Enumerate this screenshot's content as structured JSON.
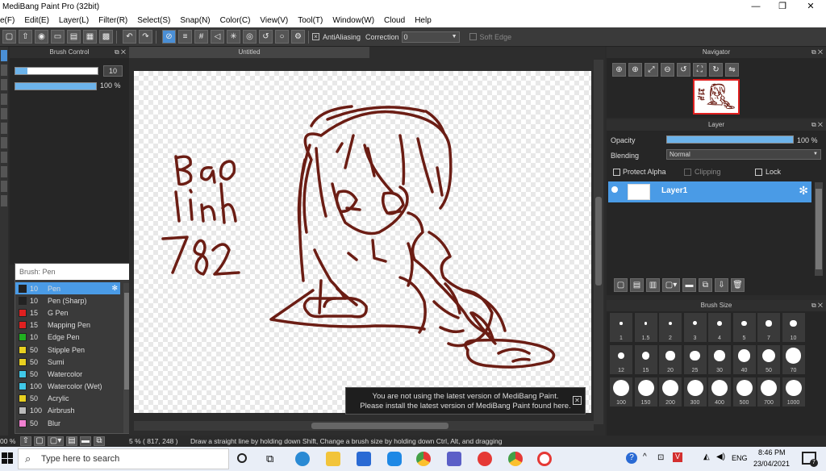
{
  "window": {
    "title": "MediBang Paint Pro (32bit)",
    "minimize": "—",
    "restore": "❐",
    "close": "✕"
  },
  "menu": [
    "e(F)",
    "Edit(E)",
    "Layer(L)",
    "Filter(R)",
    "Select(S)",
    "Snap(N)",
    "Color(C)",
    "View(V)",
    "Tool(T)",
    "Window(W)",
    "Cloud",
    "Help"
  ],
  "toolbar": {
    "antialiasing_label": "AntiAliasing",
    "correction_label": "Correction",
    "correction_value": "0",
    "soft_edge_label": "Soft Edge"
  },
  "brush_control": {
    "title": "Brush Control",
    "size_value": "10",
    "size_fraction": 0.15,
    "opacity_value": "100 %",
    "opacity_fraction": 1.0
  },
  "brush_list": {
    "header": "Brush: Pen",
    "items": [
      {
        "size": "10",
        "name": "Pen",
        "color": "#222222",
        "selected": true
      },
      {
        "size": "10",
        "name": "Pen (Sharp)",
        "color": "#222222"
      },
      {
        "size": "15",
        "name": "G Pen",
        "color": "#e02020"
      },
      {
        "size": "15",
        "name": "Mapping Pen",
        "color": "#e02020"
      },
      {
        "size": "10",
        "name": "Edge Pen",
        "color": "#20b020"
      },
      {
        "size": "50",
        "name": "Stipple Pen",
        "color": "#e8d020"
      },
      {
        "size": "50",
        "name": "Sumi",
        "color": "#e8d020"
      },
      {
        "size": "50",
        "name": "Watercolor",
        "color": "#40c8e8"
      },
      {
        "size": "100",
        "name": "Watercolor (Wet)",
        "color": "#40c8e8"
      },
      {
        "size": "50",
        "name": "Acrylic",
        "color": "#e8d020"
      },
      {
        "size": "100",
        "name": "Airbrush",
        "color": "#bbbbbb"
      },
      {
        "size": "50",
        "name": "Blur",
        "color": "#f080d0"
      }
    ]
  },
  "canvas": {
    "tab_title": "Untitled",
    "sketch_color": "#6b1d14"
  },
  "notification": {
    "line1": "You are not using the latest version of MediBang Paint.",
    "line2": "Please install the latest version of MediBang Paint found here."
  },
  "navigator": {
    "title": "Navigator"
  },
  "layer_panel": {
    "title": "Layer",
    "opacity_label": "Opacity",
    "opacity_value": "100 %",
    "opacity_fraction": 1.0,
    "blending_label": "Blending",
    "blending_value": "Normal",
    "protect_alpha": "Protect Alpha",
    "clipping": "Clipping",
    "lock": "Lock",
    "layer_name": "Layer1"
  },
  "brush_size": {
    "title": "Brush Size",
    "sizes": [
      "1",
      "1.5",
      "2",
      "3",
      "4",
      "5",
      "7",
      "10",
      "12",
      "15",
      "20",
      "25",
      "30",
      "40",
      "50",
      "70",
      "100",
      "150",
      "200",
      "300",
      "400",
      "500",
      "700",
      "1000"
    ]
  },
  "status": {
    "zoom": "00 %",
    "zoom2": "5 %",
    "coords": "( 817, 248 )",
    "hint": "Draw a straight line by holding down Shift, Change a brush size by holding down Ctrl, Alt, and dragging"
  },
  "taskbar": {
    "search_placeholder": "Type here to search",
    "lang": "ENG",
    "time": "8:46 PM",
    "date": "23/04/2021",
    "notif_count": "7"
  }
}
